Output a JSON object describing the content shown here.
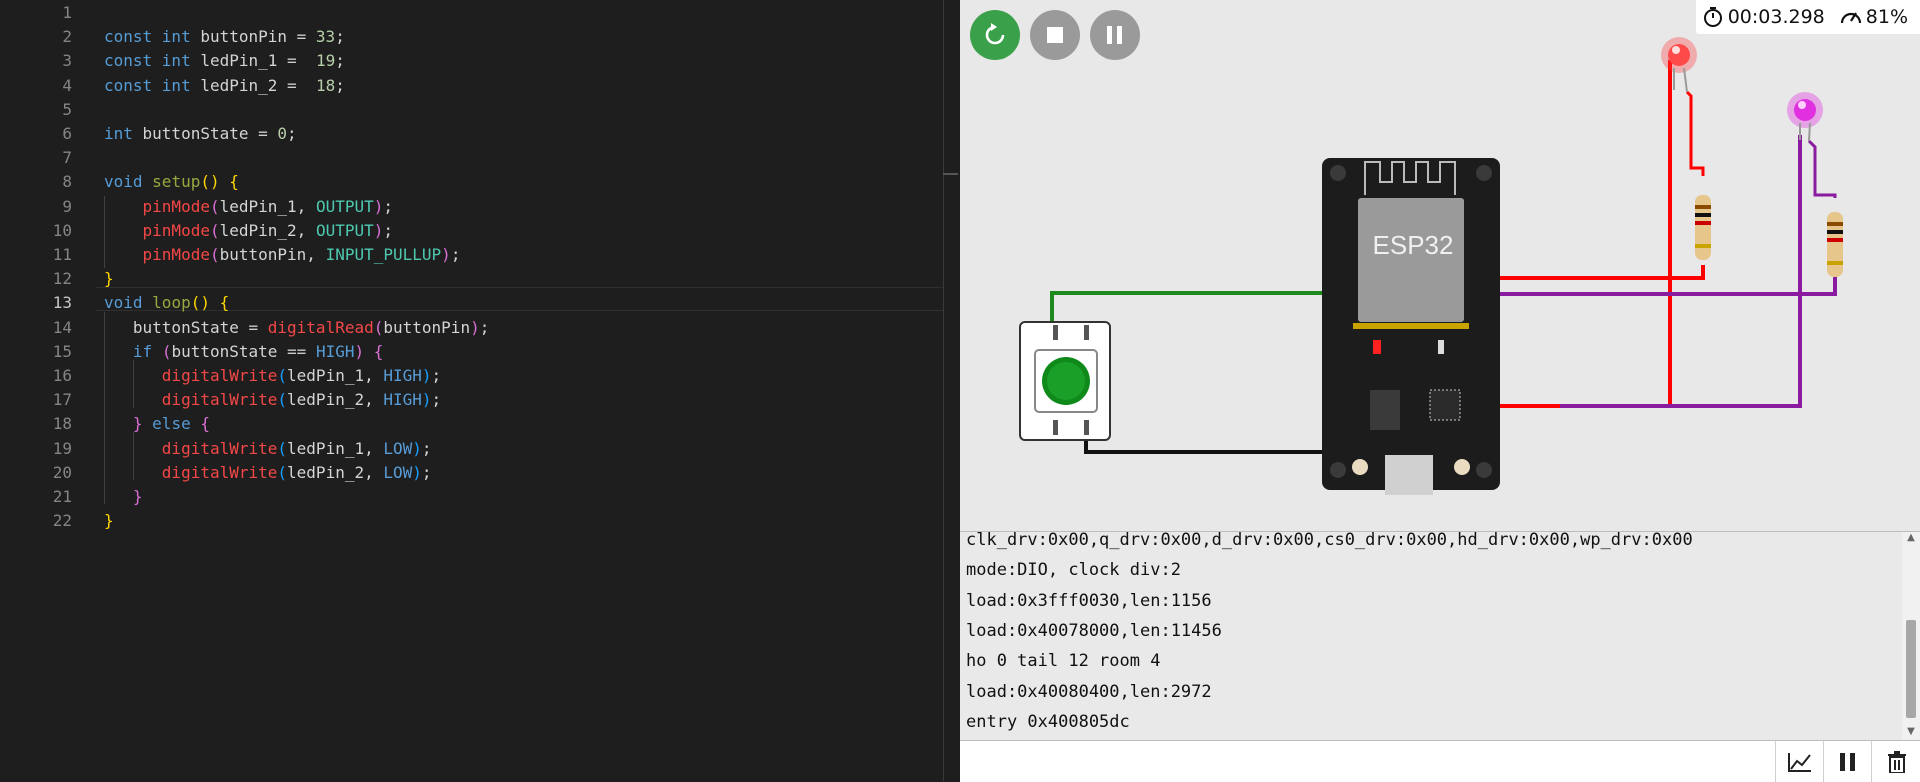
{
  "editor": {
    "active_line": 13,
    "lines": [
      {
        "num": "1",
        "tokens": []
      },
      {
        "num": "2",
        "tokens": [
          {
            "t": "const ",
            "c": "k"
          },
          {
            "t": "int ",
            "c": "k"
          },
          {
            "t": "buttonPin ",
            "c": "v"
          },
          {
            "t": "= ",
            "c": "g"
          },
          {
            "t": "33",
            "c": "n"
          },
          {
            "t": ";",
            "c": "v"
          }
        ]
      },
      {
        "num": "3",
        "tokens": [
          {
            "t": "const ",
            "c": "k"
          },
          {
            "t": "int ",
            "c": "k"
          },
          {
            "t": "ledPin_1 ",
            "c": "v"
          },
          {
            "t": "=  ",
            "c": "g"
          },
          {
            "t": "19",
            "c": "n"
          },
          {
            "t": ";",
            "c": "v"
          }
        ]
      },
      {
        "num": "4",
        "tokens": [
          {
            "t": "const ",
            "c": "k"
          },
          {
            "t": "int ",
            "c": "k"
          },
          {
            "t": "ledPin_2 ",
            "c": "v"
          },
          {
            "t": "=  ",
            "c": "g"
          },
          {
            "t": "18",
            "c": "n"
          },
          {
            "t": ";",
            "c": "v"
          }
        ]
      },
      {
        "num": "5",
        "tokens": []
      },
      {
        "num": "6",
        "tokens": [
          {
            "t": "int ",
            "c": "k"
          },
          {
            "t": "buttonState ",
            "c": "v"
          },
          {
            "t": "= ",
            "c": "g"
          },
          {
            "t": "0",
            "c": "n"
          },
          {
            "t": ";",
            "c": "v"
          }
        ]
      },
      {
        "num": "7",
        "tokens": []
      },
      {
        "num": "8",
        "tokens": [
          {
            "t": "void ",
            "c": "k"
          },
          {
            "t": "setup",
            "c": "fn"
          },
          {
            "t": "() {",
            "c": "p"
          }
        ]
      },
      {
        "num": "9",
        "tokens": [
          {
            "t": "    ",
            "c": "v"
          },
          {
            "t": "pinMode",
            "c": "f"
          },
          {
            "t": "(",
            "c": "p2"
          },
          {
            "t": "ledPin_1, ",
            "c": "v"
          },
          {
            "t": "OUTPUT",
            "c": "c"
          },
          {
            "t": ")",
            "c": "p2"
          },
          {
            "t": ";",
            "c": "v"
          }
        ]
      },
      {
        "num": "10",
        "tokens": [
          {
            "t": "    ",
            "c": "v"
          },
          {
            "t": "pinMode",
            "c": "f"
          },
          {
            "t": "(",
            "c": "p2"
          },
          {
            "t": "ledPin_2, ",
            "c": "v"
          },
          {
            "t": "OUTPUT",
            "c": "c"
          },
          {
            "t": ")",
            "c": "p2"
          },
          {
            "t": ";",
            "c": "v"
          }
        ]
      },
      {
        "num": "11",
        "tokens": [
          {
            "t": "    ",
            "c": "v"
          },
          {
            "t": "pinMode",
            "c": "f"
          },
          {
            "t": "(",
            "c": "p2"
          },
          {
            "t": "buttonPin, ",
            "c": "v"
          },
          {
            "t": "INPUT_PULLUP",
            "c": "c"
          },
          {
            "t": ")",
            "c": "p2"
          },
          {
            "t": ";",
            "c": "v"
          }
        ]
      },
      {
        "num": "12",
        "tokens": [
          {
            "t": "}",
            "c": "p"
          }
        ]
      },
      {
        "num": "13",
        "tokens": [
          {
            "t": "void ",
            "c": "k"
          },
          {
            "t": "loop",
            "c": "fn"
          },
          {
            "t": "() {",
            "c": "p"
          }
        ]
      },
      {
        "num": "14",
        "tokens": [
          {
            "t": "   buttonState ",
            "c": "v"
          },
          {
            "t": "= ",
            "c": "g"
          },
          {
            "t": "digitalRead",
            "c": "f"
          },
          {
            "t": "(",
            "c": "p2"
          },
          {
            "t": "buttonPin",
            "c": "v"
          },
          {
            "t": ")",
            "c": "p2"
          },
          {
            "t": ";",
            "c": "v"
          }
        ]
      },
      {
        "num": "15",
        "tokens": [
          {
            "t": "   ",
            "c": "v"
          },
          {
            "t": "if ",
            "c": "k"
          },
          {
            "t": "(",
            "c": "p2"
          },
          {
            "t": "buttonState ",
            "c": "v"
          },
          {
            "t": "== ",
            "c": "g"
          },
          {
            "t": "HIGH",
            "c": "k"
          },
          {
            "t": ") {",
            "c": "p2"
          }
        ]
      },
      {
        "num": "16",
        "tokens": [
          {
            "t": "      ",
            "c": "v"
          },
          {
            "t": "digitalWrite",
            "c": "f"
          },
          {
            "t": "(",
            "c": "p3"
          },
          {
            "t": "ledPin_1, ",
            "c": "v"
          },
          {
            "t": "HIGH",
            "c": "k"
          },
          {
            "t": ")",
            "c": "p3"
          },
          {
            "t": ";",
            "c": "v"
          }
        ]
      },
      {
        "num": "17",
        "tokens": [
          {
            "t": "      ",
            "c": "v"
          },
          {
            "t": "digitalWrite",
            "c": "f"
          },
          {
            "t": "(",
            "c": "p3"
          },
          {
            "t": "ledPin_2, ",
            "c": "v"
          },
          {
            "t": "HIGH",
            "c": "k"
          },
          {
            "t": ")",
            "c": "p3"
          },
          {
            "t": ";",
            "c": "v"
          }
        ]
      },
      {
        "num": "18",
        "tokens": [
          {
            "t": "   ",
            "c": "v"
          },
          {
            "t": "} ",
            "c": "p2"
          },
          {
            "t": "else ",
            "c": "k"
          },
          {
            "t": "{",
            "c": "p2"
          }
        ]
      },
      {
        "num": "19",
        "tokens": [
          {
            "t": "      ",
            "c": "v"
          },
          {
            "t": "digitalWrite",
            "c": "f"
          },
          {
            "t": "(",
            "c": "p3"
          },
          {
            "t": "ledPin_1, ",
            "c": "v"
          },
          {
            "t": "LOW",
            "c": "k"
          },
          {
            "t": ")",
            "c": "p3"
          },
          {
            "t": ";",
            "c": "v"
          }
        ]
      },
      {
        "num": "20",
        "tokens": [
          {
            "t": "      ",
            "c": "v"
          },
          {
            "t": "digitalWrite",
            "c": "f"
          },
          {
            "t": "(",
            "c": "p3"
          },
          {
            "t": "ledPin_2, ",
            "c": "v"
          },
          {
            "t": "LOW",
            "c": "k"
          },
          {
            "t": ")",
            "c": "p3"
          },
          {
            "t": ";",
            "c": "v"
          }
        ]
      },
      {
        "num": "21",
        "tokens": [
          {
            "t": "   ",
            "c": "v"
          },
          {
            "t": "}",
            "c": "p2"
          }
        ]
      },
      {
        "num": "22",
        "tokens": [
          {
            "t": "}",
            "c": "p"
          }
        ]
      }
    ]
  },
  "simulator": {
    "timer": "00:03.298",
    "speed": "81%",
    "board_label": "ESP32",
    "icons": {
      "restart": "restart-icon",
      "stop": "stop-icon",
      "pause": "pause-icon",
      "timer": "stopwatch-icon",
      "speed": "speedometer-icon"
    },
    "colors": {
      "led_red": "#ff3b3b",
      "led_magenta": "#e020e0",
      "wire_red": "#ff0000",
      "wire_green": "#1e8a1e",
      "wire_purple": "#8a1aa0",
      "wire_black": "#111111",
      "button_green": "#0f8a1a"
    }
  },
  "serial": {
    "lines": [
      "clk_drv:0x00,q_drv:0x00,d_drv:0x00,cs0_drv:0x00,hd_drv:0x00,wp_drv:0x00",
      "mode:DIO, clock div:2",
      "load:0x3fff0030,len:1156",
      "load:0x40078000,len:11456",
      "ho 0 tail 12 room 4",
      "load:0x40080400,len:2972",
      "entry 0x400805dc"
    ],
    "input_value": "",
    "toolbar": {
      "plotter": "chart-icon",
      "pause": "pause-icon",
      "clear": "trash-icon"
    }
  }
}
